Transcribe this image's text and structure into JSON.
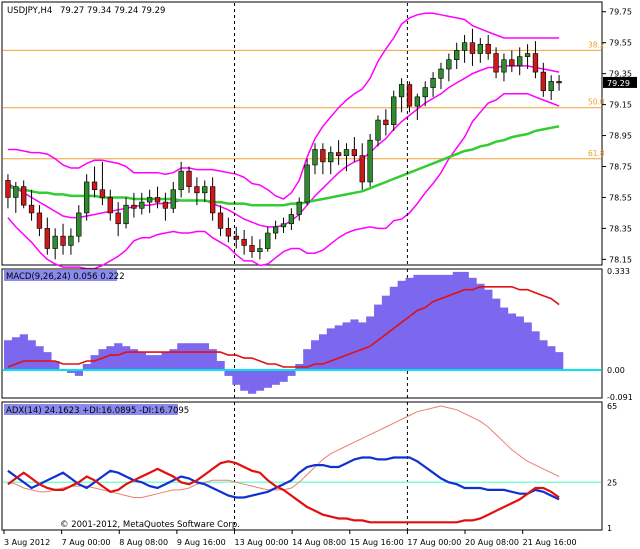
{
  "colors": {
    "background": "#ffffff",
    "frame": "#000000",
    "bull_candle": "#2e8b2e",
    "bear_candle": "#cc1a1a",
    "bollinger": "#ff00ff",
    "moving_average": "#33cc33",
    "fibo": "#f0a030",
    "macd_hist": "#7b68ee",
    "macd_signal": "#e01010",
    "zero_line": "#00e5ee",
    "adx_main": "#e88070",
    "plus_di": "#1030d0",
    "minus_di": "#e01010",
    "adx_level": "#7fffd4",
    "price_badge": "#000000",
    "label_bg": "#8a8aee"
  },
  "header": {
    "symbol_timeframe": "USDJPY,H4",
    "ohlc": "79.27 79.34 79.24 79.29"
  },
  "price_axis": {
    "ticks": [
      "79.75",
      "79.55",
      "79.35",
      "79.15",
      "78.95",
      "78.75",
      "78.55",
      "78.35",
      "78.15"
    ],
    "current_price": "79.29"
  },
  "fibo_levels": [
    {
      "label": "38.2",
      "price": 79.5
    },
    {
      "label": "50.0",
      "price": 79.13
    },
    {
      "label": "61.8",
      "price": 78.8
    }
  ],
  "macd": {
    "label": "MACD(9,26,24) 0.056 0.222",
    "axis_ticks": [
      "0.333",
      "0.00",
      "-0.091"
    ],
    "range": [
      -0.091,
      0.333
    ]
  },
  "adx": {
    "label": "ADX(14) 24.1623 +DI:16.0895 -DI:16.7095",
    "axis_ticks": [
      "65",
      "25",
      "1"
    ],
    "range": [
      1,
      65
    ],
    "level": 25
  },
  "time_axis": [
    "3 Aug 2012",
    "7 Aug 00:00",
    "8 Aug 08:00",
    "9 Aug 16:00",
    "13 Aug 00:00",
    "14 Aug 08:00",
    "15 Aug 16:00",
    "17 Aug 00:00",
    "20 Aug 08:00",
    "21 Aug 16:00"
  ],
  "copyright": "© 2001-2012, MetaQuotes Software Corp.",
  "chart_data": [
    {
      "type": "candlestick",
      "name": "USDJPY,H4",
      "ylim": [
        78.12,
        79.8
      ],
      "candles": [
        [
          78.66,
          78.7,
          78.48,
          78.55
        ],
        [
          78.55,
          78.65,
          78.45,
          78.62
        ],
        [
          78.62,
          78.66,
          78.48,
          78.5
        ],
        [
          78.5,
          78.6,
          78.4,
          78.45
        ],
        [
          78.45,
          78.5,
          78.3,
          78.35
        ],
        [
          78.35,
          78.42,
          78.18,
          78.22
        ],
        [
          78.22,
          78.35,
          78.15,
          78.3
        ],
        [
          78.3,
          78.38,
          78.18,
          78.24
        ],
        [
          78.24,
          78.35,
          78.18,
          78.3
        ],
        [
          78.3,
          78.5,
          78.26,
          78.45
        ],
        [
          78.45,
          78.7,
          78.4,
          78.65
        ],
        [
          78.65,
          78.75,
          78.55,
          78.6
        ],
        [
          78.6,
          78.78,
          78.5,
          78.55
        ],
        [
          78.55,
          78.6,
          78.4,
          78.45
        ],
        [
          78.45,
          78.52,
          78.3,
          78.38
        ],
        [
          78.38,
          78.55,
          78.35,
          78.5
        ],
        [
          78.5,
          78.58,
          78.42,
          78.48
        ],
        [
          78.48,
          78.58,
          78.44,
          78.52
        ],
        [
          78.52,
          78.6,
          78.45,
          78.55
        ],
        [
          78.55,
          78.62,
          78.48,
          78.52
        ],
        [
          78.52,
          78.58,
          78.4,
          78.48
        ],
        [
          78.48,
          78.65,
          78.45,
          78.6
        ],
        [
          78.6,
          78.78,
          78.55,
          78.72
        ],
        [
          78.72,
          78.75,
          78.58,
          78.62
        ],
        [
          78.62,
          78.68,
          78.5,
          78.58
        ],
        [
          78.58,
          78.66,
          78.52,
          78.62
        ],
        [
          78.62,
          78.68,
          78.4,
          78.45
        ],
        [
          78.45,
          78.5,
          78.3,
          78.35
        ],
        [
          78.35,
          78.42,
          78.26,
          78.3
        ],
        [
          78.3,
          78.36,
          78.22,
          78.28
        ],
        [
          78.28,
          78.34,
          78.18,
          78.24
        ],
        [
          78.24,
          78.3,
          78.16,
          78.2
        ],
        [
          78.2,
          78.28,
          78.15,
          78.22
        ],
        [
          78.22,
          78.36,
          78.2,
          78.32
        ],
        [
          78.32,
          78.4,
          78.28,
          78.36
        ],
        [
          78.36,
          78.42,
          78.32,
          78.38
        ],
        [
          78.38,
          78.48,
          78.34,
          78.44
        ],
        [
          78.44,
          78.55,
          78.4,
          78.52
        ],
        [
          78.52,
          78.8,
          78.5,
          78.76
        ],
        [
          78.76,
          78.9,
          78.7,
          78.86
        ],
        [
          78.86,
          78.9,
          78.7,
          78.78
        ],
        [
          78.78,
          78.88,
          78.7,
          78.84
        ],
        [
          78.84,
          78.92,
          78.76,
          78.82
        ],
        [
          78.82,
          78.9,
          78.72,
          78.86
        ],
        [
          78.86,
          78.94,
          78.78,
          78.82
        ],
        [
          78.82,
          78.9,
          78.6,
          78.65
        ],
        [
          78.65,
          78.96,
          78.62,
          78.92
        ],
        [
          78.92,
          79.08,
          78.88,
          79.05
        ],
        [
          79.05,
          79.12,
          78.95,
          79.02
        ],
        [
          79.02,
          79.24,
          78.98,
          79.2
        ],
        [
          79.2,
          79.32,
          79.1,
          79.28
        ],
        [
          79.28,
          79.3,
          79.1,
          79.14
        ],
        [
          79.14,
          79.22,
          79.05,
          79.2
        ],
        [
          79.2,
          79.3,
          79.14,
          79.26
        ],
        [
          79.26,
          79.36,
          79.2,
          79.32
        ],
        [
          79.32,
          79.42,
          79.25,
          79.38
        ],
        [
          79.38,
          79.48,
          79.3,
          79.44
        ],
        [
          79.44,
          79.55,
          79.38,
          79.5
        ],
        [
          79.5,
          79.6,
          79.42,
          79.55
        ],
        [
          79.55,
          79.64,
          79.4,
          79.48
        ],
        [
          79.48,
          79.58,
          79.42,
          79.54
        ],
        [
          79.54,
          79.6,
          79.44,
          79.48
        ],
        [
          79.48,
          79.52,
          79.32,
          79.36
        ],
        [
          79.36,
          79.48,
          79.3,
          79.44
        ],
        [
          79.44,
          79.5,
          79.36,
          79.4
        ],
        [
          79.4,
          79.52,
          79.34,
          79.46
        ],
        [
          79.46,
          79.54,
          79.38,
          79.48
        ],
        [
          79.48,
          79.56,
          79.32,
          79.36
        ],
        [
          79.36,
          79.42,
          79.2,
          79.24
        ],
        [
          79.24,
          79.34,
          79.18,
          79.3
        ],
        [
          79.3,
          79.34,
          79.24,
          79.29
        ]
      ],
      "bollinger_upper": [
        78.86,
        78.86,
        78.85,
        78.84,
        78.84,
        78.83,
        78.8,
        78.76,
        78.74,
        78.74,
        78.77,
        78.79,
        78.79,
        78.78,
        78.77,
        78.75,
        78.71,
        78.71,
        78.71,
        78.71,
        78.7,
        78.71,
        78.74,
        78.74,
        78.73,
        78.73,
        78.73,
        78.72,
        78.71,
        78.7,
        78.68,
        78.64,
        78.63,
        78.6,
        78.56,
        78.54,
        78.58,
        78.66,
        78.81,
        78.93,
        79.01,
        79.07,
        79.13,
        79.18,
        79.22,
        79.25,
        79.32,
        79.43,
        79.51,
        79.58,
        79.67,
        79.71,
        79.73,
        79.74,
        79.74,
        79.73,
        79.72,
        79.71,
        79.7,
        79.66,
        79.64,
        79.62,
        79.6,
        79.58,
        79.58,
        79.58,
        79.58,
        79.58,
        79.58,
        79.58,
        79.58
      ],
      "bollinger_middle": [
        78.64,
        78.61,
        78.58,
        78.55,
        78.52,
        78.49,
        78.46,
        78.43,
        78.42,
        78.42,
        78.43,
        78.44,
        78.45,
        78.46,
        78.47,
        78.48,
        78.49,
        78.5,
        78.5,
        78.51,
        78.51,
        78.52,
        78.53,
        78.53,
        78.53,
        78.53,
        78.51,
        78.49,
        78.47,
        78.44,
        78.41,
        78.39,
        78.37,
        78.36,
        78.36,
        78.37,
        78.4,
        78.44,
        78.5,
        78.56,
        78.61,
        78.66,
        78.71,
        78.75,
        78.78,
        78.8,
        78.84,
        78.89,
        78.93,
        78.99,
        79.04,
        79.08,
        79.12,
        79.16,
        79.19,
        79.22,
        79.26,
        79.29,
        79.32,
        79.35,
        79.37,
        79.39,
        79.39,
        79.4,
        79.4,
        79.4,
        79.4,
        79.39,
        79.38,
        79.37,
        79.36
      ],
      "bollinger_lower": [
        78.42,
        78.36,
        78.31,
        78.26,
        78.2,
        78.15,
        78.12,
        78.1,
        78.1,
        78.1,
        78.09,
        78.09,
        78.11,
        78.14,
        78.17,
        78.21,
        78.27,
        78.29,
        78.29,
        78.31,
        78.32,
        78.33,
        78.32,
        78.32,
        78.33,
        78.33,
        78.29,
        78.26,
        78.23,
        78.18,
        78.14,
        78.14,
        78.11,
        78.12,
        78.16,
        78.2,
        78.22,
        78.22,
        78.19,
        78.19,
        78.21,
        78.25,
        78.29,
        78.32,
        78.34,
        78.35,
        78.36,
        78.35,
        78.35,
        78.4,
        78.41,
        78.45,
        78.51,
        78.58,
        78.64,
        78.71,
        78.8,
        78.87,
        78.94,
        79.04,
        79.1,
        79.16,
        79.18,
        79.22,
        79.22,
        79.22,
        79.22,
        79.2,
        79.18,
        79.16,
        79.14
      ],
      "moving_average": [
        78.62,
        78.61,
        78.6,
        78.59,
        78.58,
        78.58,
        78.57,
        78.57,
        78.56,
        78.56,
        78.56,
        78.56,
        78.55,
        78.55,
        78.55,
        78.55,
        78.54,
        78.54,
        78.54,
        78.54,
        78.54,
        78.54,
        78.53,
        78.53,
        78.53,
        78.53,
        78.52,
        78.52,
        78.51,
        78.51,
        78.51,
        78.5,
        78.5,
        78.5,
        78.5,
        78.5,
        78.51,
        78.51,
        78.52,
        78.53,
        78.54,
        78.55,
        78.56,
        78.57,
        78.58,
        78.59,
        78.61,
        78.63,
        78.65,
        78.67,
        78.69,
        78.71,
        78.73,
        78.75,
        78.77,
        78.79,
        78.81,
        78.83,
        78.85,
        78.86,
        78.88,
        78.89,
        78.91,
        78.92,
        78.94,
        78.95,
        78.96,
        78.98,
        78.99,
        79.0,
        79.01
      ]
    },
    {
      "type": "bar",
      "name": "MACD(9,26,24)",
      "ylim": [
        -0.091,
        0.333
      ],
      "values": [
        0.1,
        0.11,
        0.12,
        0.1,
        0.08,
        0.06,
        0.03,
        0.0,
        -0.01,
        -0.02,
        0.02,
        0.05,
        0.07,
        0.08,
        0.09,
        0.08,
        0.07,
        0.06,
        0.05,
        0.05,
        0.06,
        0.07,
        0.09,
        0.09,
        0.09,
        0.09,
        0.07,
        0.03,
        -0.02,
        -0.05,
        -0.07,
        -0.08,
        -0.07,
        -0.06,
        -0.05,
        -0.04,
        -0.02,
        0.02,
        0.07,
        0.1,
        0.12,
        0.14,
        0.15,
        0.16,
        0.17,
        0.16,
        0.18,
        0.22,
        0.25,
        0.28,
        0.3,
        0.31,
        0.32,
        0.32,
        0.32,
        0.32,
        0.32,
        0.33,
        0.33,
        0.31,
        0.29,
        0.27,
        0.24,
        0.21,
        0.19,
        0.18,
        0.16,
        0.13,
        0.1,
        0.08,
        0.06
      ],
      "signal": [
        0.01,
        0.02,
        0.03,
        0.03,
        0.03,
        0.03,
        0.03,
        0.02,
        0.02,
        0.02,
        0.03,
        0.03,
        0.04,
        0.05,
        0.05,
        0.06,
        0.06,
        0.06,
        0.06,
        0.06,
        0.06,
        0.06,
        0.06,
        0.06,
        0.06,
        0.06,
        0.06,
        0.06,
        0.05,
        0.05,
        0.04,
        0.04,
        0.03,
        0.02,
        0.02,
        0.01,
        0.01,
        0.01,
        0.01,
        0.02,
        0.02,
        0.03,
        0.04,
        0.05,
        0.06,
        0.07,
        0.08,
        0.1,
        0.12,
        0.14,
        0.16,
        0.18,
        0.2,
        0.21,
        0.23,
        0.24,
        0.25,
        0.26,
        0.27,
        0.27,
        0.28,
        0.28,
        0.28,
        0.28,
        0.28,
        0.27,
        0.27,
        0.26,
        0.25,
        0.24,
        0.22
      ]
    },
    {
      "type": "line",
      "name": "ADX(14)",
      "ylim": [
        1,
        65
      ],
      "series": [
        {
          "name": "ADX",
          "values": [
            25,
            24,
            22,
            21,
            20,
            20,
            21,
            22,
            23,
            23,
            23,
            22,
            21,
            20,
            19,
            18,
            17,
            17,
            18,
            19,
            20,
            21,
            21,
            22,
            24,
            25,
            26,
            26,
            26,
            25,
            24,
            23,
            22,
            21,
            21,
            21,
            22,
            25,
            29,
            33,
            37,
            40,
            42,
            44,
            46,
            48,
            50,
            52,
            54,
            56,
            58,
            60,
            62,
            63,
            64,
            65,
            64,
            63,
            61,
            59,
            57,
            54,
            50,
            46,
            42,
            39,
            36,
            34,
            32,
            30,
            28
          ]
        },
        {
          "name": "+DI",
          "values": [
            31,
            28,
            25,
            22,
            24,
            26,
            28,
            30,
            27,
            24,
            22,
            25,
            28,
            31,
            30,
            28,
            26,
            25,
            23,
            22,
            24,
            26,
            28,
            27,
            25,
            24,
            22,
            20,
            18,
            17,
            17,
            18,
            19,
            20,
            22,
            24,
            26,
            30,
            33,
            34,
            34,
            33,
            33,
            35,
            37,
            38,
            38,
            37,
            37,
            38,
            38,
            38,
            36,
            33,
            30,
            27,
            25,
            24,
            22,
            22,
            22,
            21,
            21,
            21,
            20,
            19,
            19,
            21,
            20,
            18,
            16
          ]
        },
        {
          "name": "-DI",
          "values": [
            24,
            27,
            30,
            27,
            24,
            22,
            21,
            21,
            23,
            25,
            28,
            26,
            23,
            20,
            21,
            24,
            26,
            28,
            30,
            32,
            30,
            28,
            25,
            24,
            26,
            29,
            32,
            35,
            36,
            35,
            33,
            31,
            30,
            26,
            23,
            21,
            18,
            15,
            12,
            10,
            8,
            7,
            6,
            6,
            5,
            5,
            4,
            4,
            4,
            4,
            4,
            4,
            4,
            4,
            4,
            4,
            4,
            4,
            5,
            5,
            6,
            8,
            10,
            12,
            14,
            16,
            19,
            22,
            22,
            20,
            17
          ]
        }
      ]
    }
  ]
}
